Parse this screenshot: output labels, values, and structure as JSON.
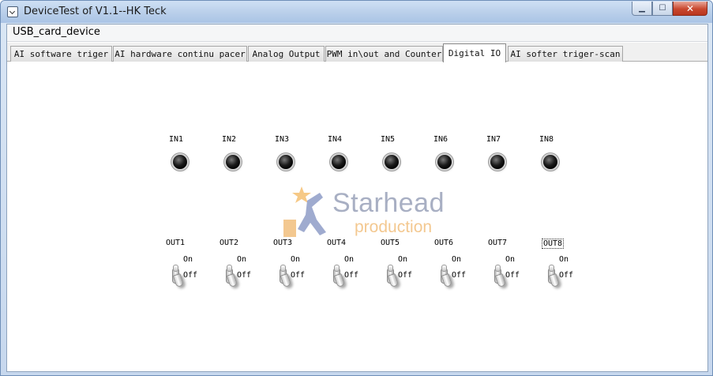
{
  "window": {
    "title": "DeviceTest of V1.1--HK Teck",
    "minimize_glyph": "▁",
    "maximize_glyph": "☐",
    "close_glyph": "✕"
  },
  "menu": {
    "items": [
      "USB_card_device"
    ]
  },
  "tabs": [
    {
      "label": "AI software triger",
      "active": false
    },
    {
      "label": "AI hardware continu pacer",
      "active": false
    },
    {
      "label": "Analog Output",
      "active": false
    },
    {
      "label": "PWM in\\out and Counter",
      "active": false
    },
    {
      "label": "Digital IO",
      "active": true
    },
    {
      "label": "AI softer triger-scan",
      "active": false
    }
  ],
  "digital_io": {
    "inputs": [
      {
        "label": "IN1",
        "state": "off"
      },
      {
        "label": "IN2",
        "state": "off"
      },
      {
        "label": "IN3",
        "state": "off"
      },
      {
        "label": "IN4",
        "state": "off"
      },
      {
        "label": "IN5",
        "state": "off"
      },
      {
        "label": "IN6",
        "state": "off"
      },
      {
        "label": "IN7",
        "state": "off"
      },
      {
        "label": "IN8",
        "state": "off"
      }
    ],
    "outputs": [
      {
        "label": "OUT1",
        "on_label": "On",
        "off_label": "Off",
        "state": "off"
      },
      {
        "label": "OUT2",
        "on_label": "On",
        "off_label": "Off",
        "state": "off"
      },
      {
        "label": "OUT3",
        "on_label": "On",
        "off_label": "Off",
        "state": "off"
      },
      {
        "label": "OUT4",
        "on_label": "On",
        "off_label": "Off",
        "state": "off"
      },
      {
        "label": "OUT5",
        "on_label": "On",
        "off_label": "Off",
        "state": "off"
      },
      {
        "label": "OUT6",
        "on_label": "On",
        "off_label": "Off",
        "state": "off"
      },
      {
        "label": "OUT7",
        "on_label": "On",
        "off_label": "Off",
        "state": "off"
      },
      {
        "label": "OUT8",
        "on_label": "On",
        "off_label": "Off",
        "state": "off",
        "focused": true
      }
    ]
  },
  "watermark": {
    "title": "Starhead",
    "subtitle": "production"
  },
  "colors": {
    "led_off": "#000000",
    "title_bar": "#b9cfea",
    "close_button": "#c9482f",
    "watermark_orange": "#f0b66b"
  },
  "icons": {
    "app": "app-window-icon",
    "led": "led-indicator-icon",
    "toggle": "toggle-switch-icon",
    "watermark": "starhead-logo-icon"
  }
}
